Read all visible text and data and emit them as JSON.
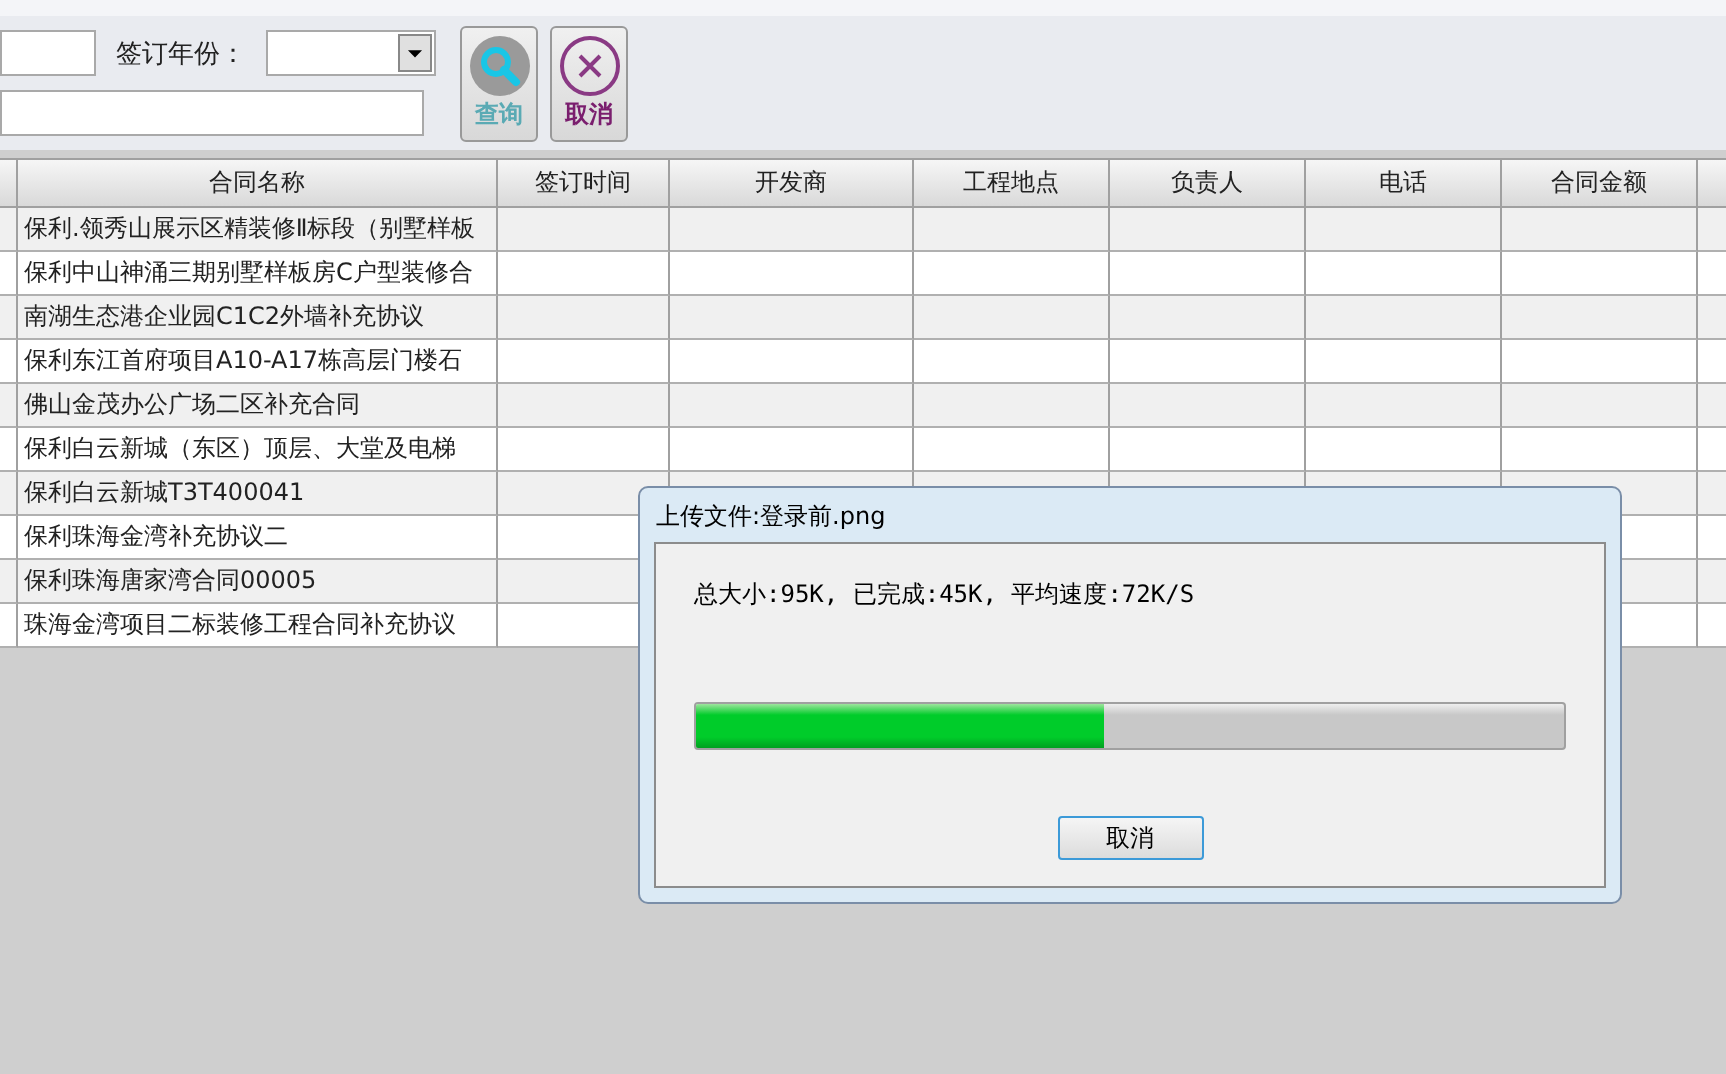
{
  "toolbar": {
    "year_label": "签订年份：",
    "buttons": [
      {
        "label": "查询",
        "kind": "search"
      },
      {
        "label": "取消",
        "kind": "cancel"
      }
    ]
  },
  "table": {
    "columns": [
      "合同名称",
      "签订时间",
      "开发商",
      "工程地点",
      "负责人",
      "电话",
      "合同金额"
    ],
    "rows": [
      {
        "name": "保利.领秀山展示区精装修Ⅱ标段（别墅样板"
      },
      {
        "name": "保利中山神涌三期别墅样板房C户型装修合"
      },
      {
        "name": "南湖生态港企业园C1C2外墙补充协议"
      },
      {
        "name": "保利东江首府项目A10-A17栋高层门楼石"
      },
      {
        "name": "佛山金茂办公广场二区补充合同"
      },
      {
        "name": "保利白云新城（东区）顶层、大堂及电梯"
      },
      {
        "name": "保利白云新城T3T400041"
      },
      {
        "name": "保利珠海金湾补充协议二"
      },
      {
        "name": "保利珠海唐家湾合同00005"
      },
      {
        "name": "珠海金湾项目二标装修工程合同补充协议"
      }
    ]
  },
  "dialog": {
    "title": "上传文件:登录前.png",
    "status": "总大小:95K, 已完成:45K, 平均速度:72K/S",
    "level": 0.47,
    "button": "取消"
  }
}
